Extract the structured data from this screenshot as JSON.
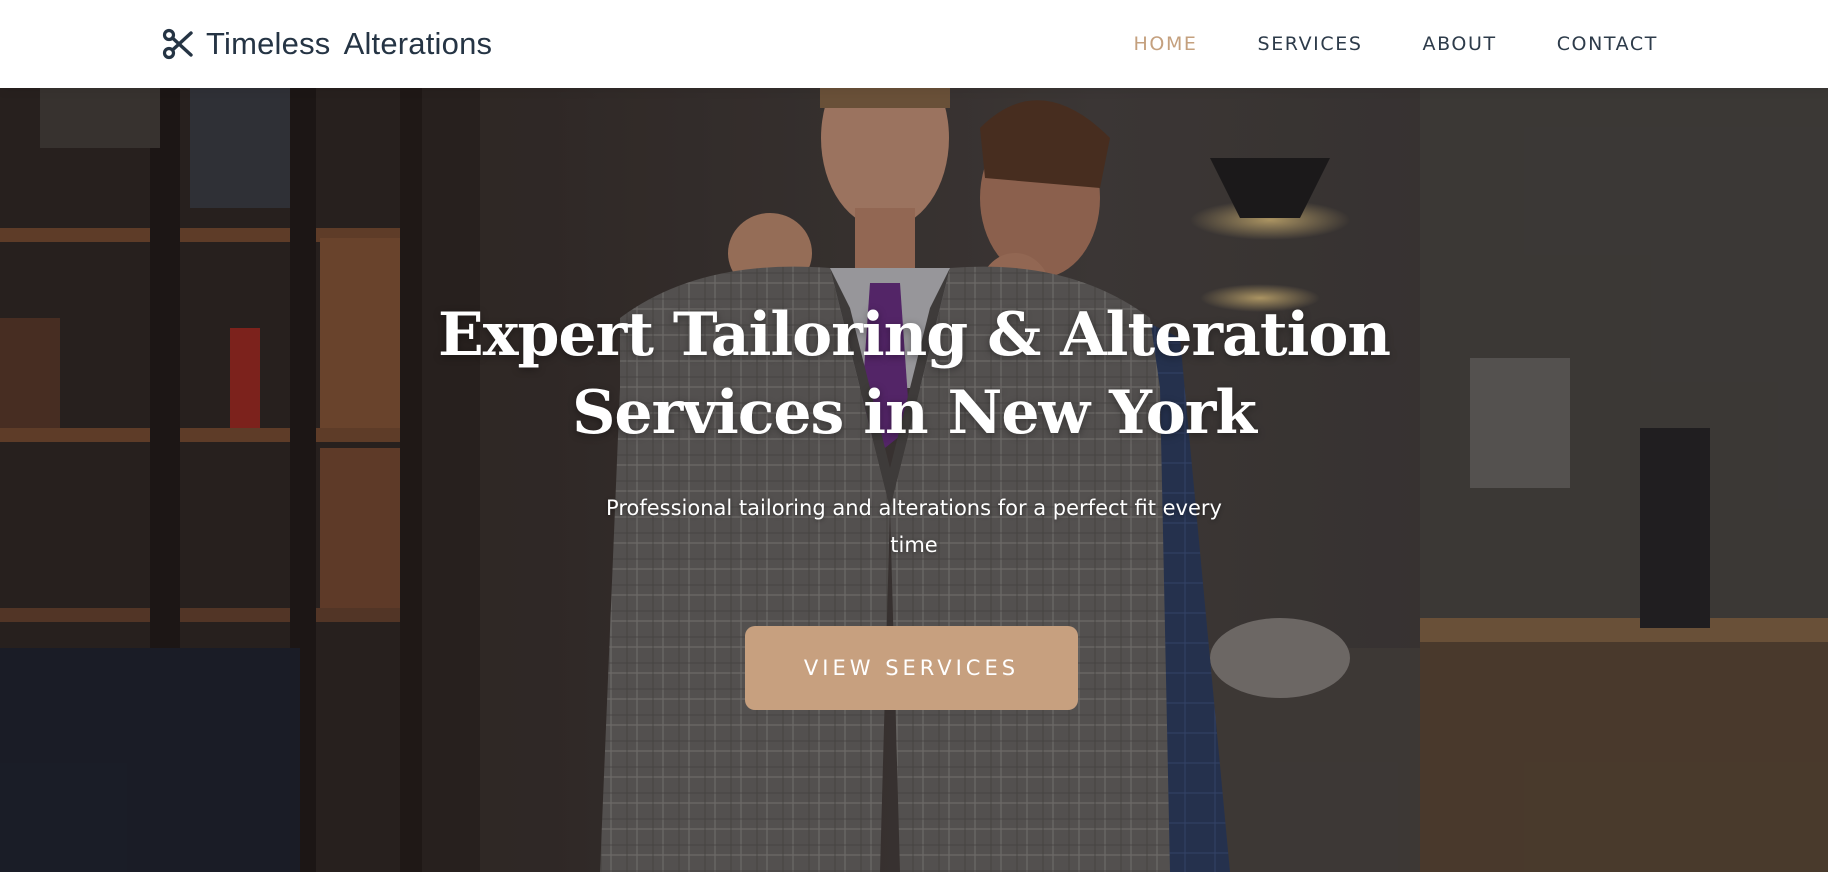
{
  "brand": {
    "name": "Timeless  Alterations",
    "icon": "scissors-icon"
  },
  "nav": {
    "items": [
      {
        "label": "HOME",
        "active": true
      },
      {
        "label": "SERVICES",
        "active": false
      },
      {
        "label": "ABOUT",
        "active": false
      },
      {
        "label": "CONTACT",
        "active": false
      }
    ]
  },
  "hero": {
    "title_line1": "Expert Tailoring & Alteration",
    "title_line2": "Services in New York",
    "subtitle": "Professional tailoring and alterations for a perfect fit every time",
    "button_label": "VIEW SERVICES",
    "image": "tailor-fitting-suit-photo"
  },
  "colors": {
    "accent": "#c4a07e",
    "button": "#c7a07f",
    "nav_text": "#2d3b4a",
    "brand_text": "#253444",
    "header_bg": "#ffffff"
  }
}
